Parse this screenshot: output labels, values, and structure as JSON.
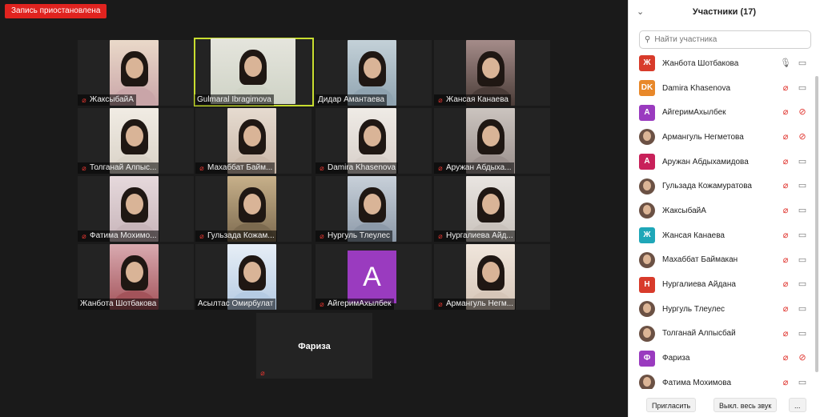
{
  "recording_badge": "Запись приостановлена",
  "gallery": {
    "tiles": [
      {
        "name": "ЖаксыбайА",
        "muted": true
      },
      {
        "name": "Gulmaral Ibragimova",
        "muted": false,
        "active": true
      },
      {
        "name": "Дидар Амантаева",
        "muted": false
      },
      {
        "name": "Жансая Канаева",
        "muted": true
      },
      {
        "name": "Толганай Алпыс...",
        "muted": true
      },
      {
        "name": "Махаббат Байм...",
        "muted": true
      },
      {
        "name": "Damira Khasenova",
        "muted": true
      },
      {
        "name": "Аружан Абдыха...",
        "muted": true
      },
      {
        "name": "Фатима Мохимо...",
        "muted": true
      },
      {
        "name": "Гульзада Кожам...",
        "muted": true
      },
      {
        "name": "Нургуль Тлеулес",
        "muted": true
      },
      {
        "name": "Нургалиева Айд...",
        "muted": true
      },
      {
        "name": "Жанбота Шотбакова",
        "muted": false
      },
      {
        "name": "Асылтас Омирбулат",
        "muted": false
      },
      {
        "name": "АйгеримАхылбек",
        "muted": true,
        "avatar_letter": "A"
      },
      {
        "name": "Армангуль Негм...",
        "muted": true
      }
    ],
    "name_only_tile": {
      "name": "Фариза",
      "muted": true
    }
  },
  "panel": {
    "title": "Участники (17)",
    "search_placeholder": "Найти участника",
    "participants": [
      {
        "initials": "Ж",
        "color": "#d83b2b",
        "name": "Жанбота Шотбакова",
        "mic_on": true,
        "video_off": false
      },
      {
        "initials": "DK",
        "color": "#e8882a",
        "name": "Damira Khasenova",
        "mic_on": false,
        "video_off": false
      },
      {
        "initials": "A",
        "color": "#9a3bbf",
        "name": "АйгеримАхылбек",
        "mic_on": false,
        "video_off": true
      },
      {
        "initials": "",
        "color": "photo",
        "name": "Армангуль Негметова",
        "mic_on": false,
        "video_off": true
      },
      {
        "initials": "A",
        "color": "#c8215a",
        "name": "Аружан Абдыхамидова",
        "mic_on": false,
        "video_off": false
      },
      {
        "initials": "",
        "color": "photo",
        "name": "Гульзада Кожамуратова",
        "mic_on": false,
        "video_off": false
      },
      {
        "initials": "",
        "color": "photo",
        "name": "ЖаксыбайА",
        "mic_on": false,
        "video_off": false
      },
      {
        "initials": "Ж",
        "color": "#1fa7b8",
        "name": "Жансая Канаева",
        "mic_on": false,
        "video_off": false
      },
      {
        "initials": "",
        "color": "photo",
        "name": "Махаббат Баймакан",
        "mic_on": false,
        "video_off": false
      },
      {
        "initials": "Н",
        "color": "#d83b2b",
        "name": "Нургалиева Айдана",
        "mic_on": false,
        "video_off": false
      },
      {
        "initials": "",
        "color": "photo",
        "name": "Нургуль Тлеулес",
        "mic_on": false,
        "video_off": false
      },
      {
        "initials": "",
        "color": "photo",
        "name": "Толганай Алпысбай",
        "mic_on": false,
        "video_off": false
      },
      {
        "initials": "Ф",
        "color": "#9a3bbf",
        "name": "Фариза",
        "mic_on": false,
        "video_off": true
      },
      {
        "initials": "",
        "color": "photo",
        "name": "Фатима Мохимова",
        "mic_on": false,
        "video_off": false
      }
    ],
    "invite_label": "Пригласить",
    "mute_all_label": "Выкл. весь звук",
    "more_label": "..."
  }
}
